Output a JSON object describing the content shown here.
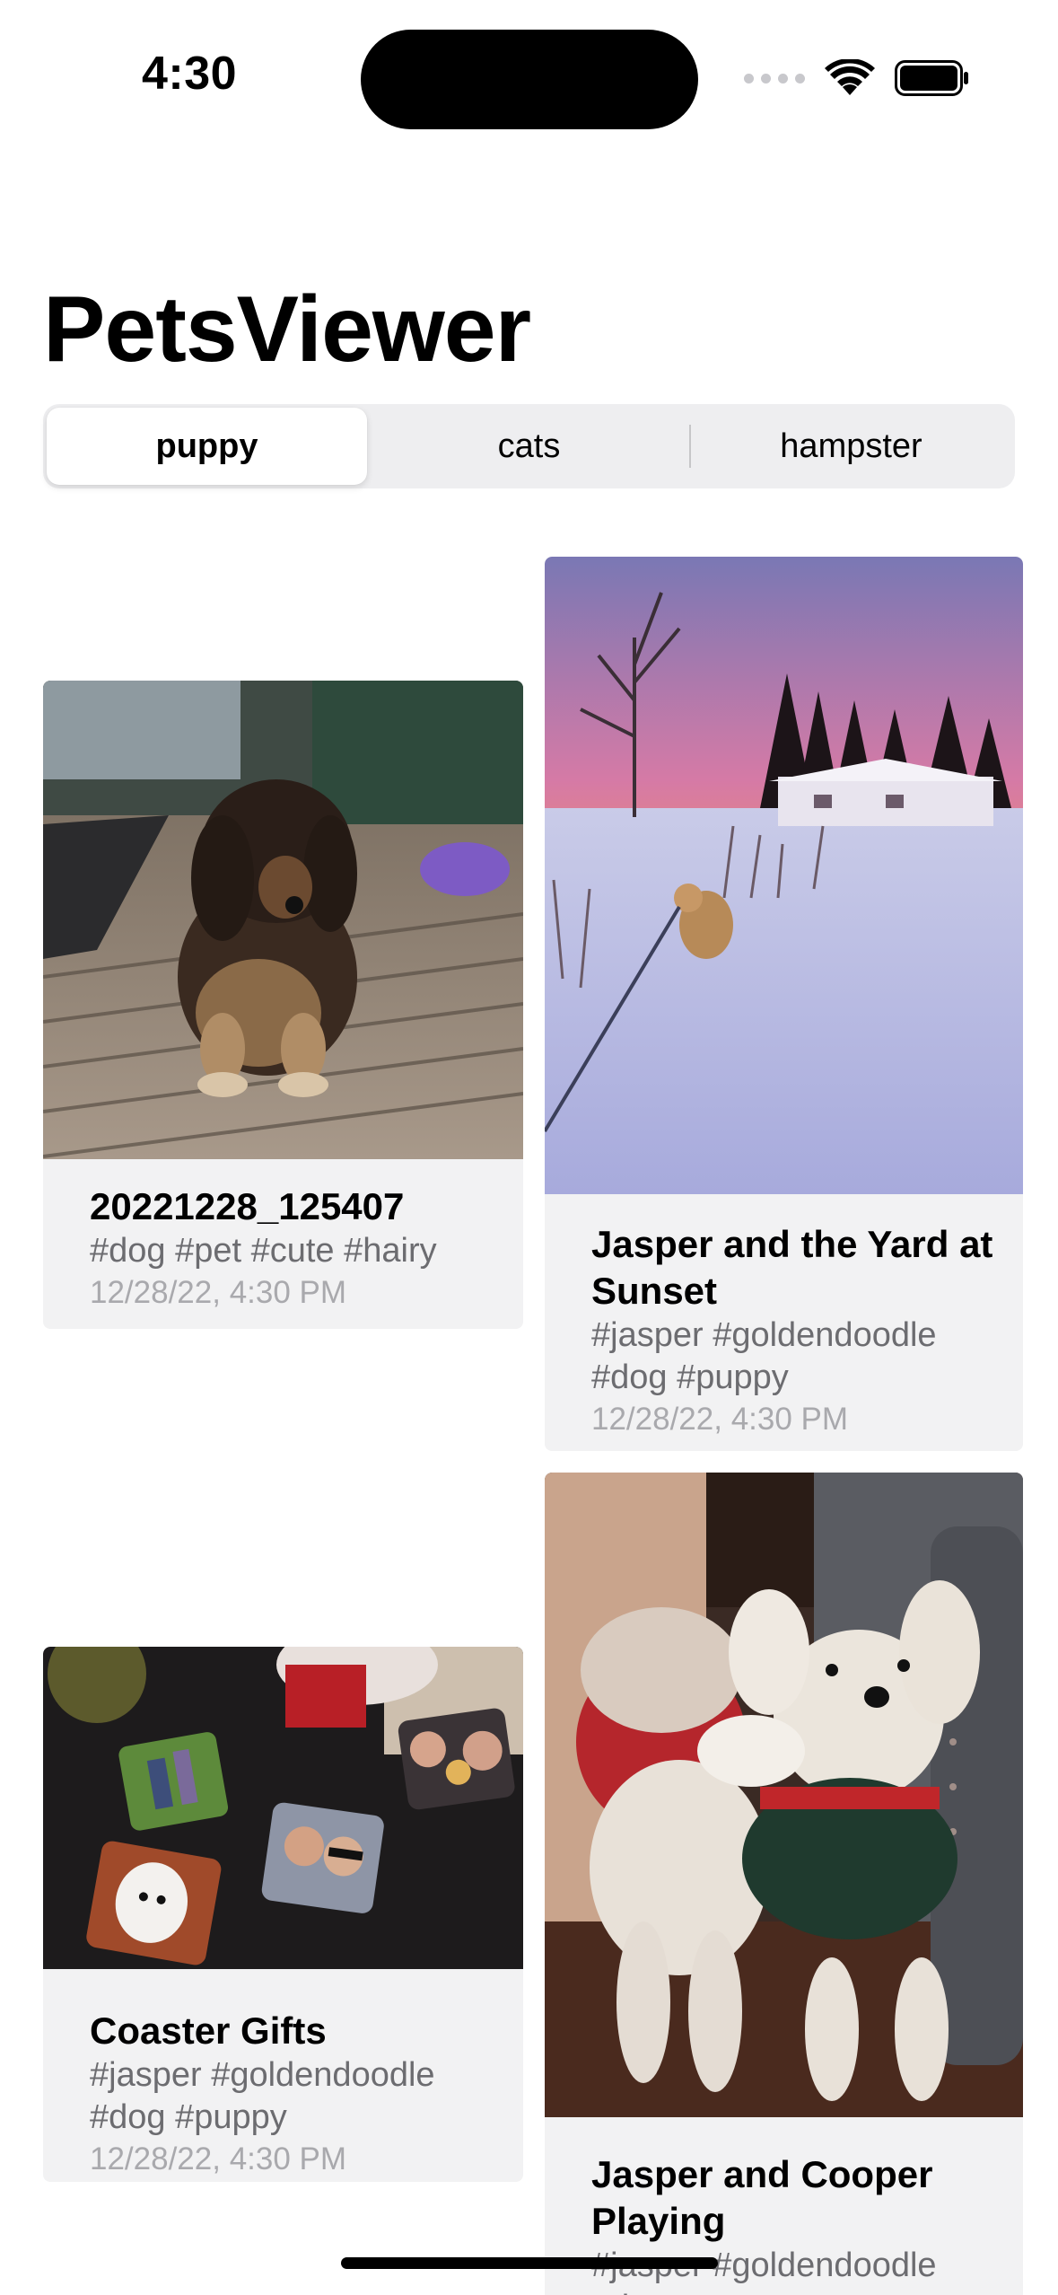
{
  "status_bar": {
    "time": "4:30"
  },
  "app": {
    "title": "PetsViewer"
  },
  "segments": [
    "puppy",
    "cats",
    "hampster"
  ],
  "selected_segment": "puppy",
  "cards": [
    {
      "title": "20221228_125407",
      "tags": "#dog #pet #cute #hairy",
      "date": "12/28/22, 4:30 PM",
      "photo_icon": "dog-on-deck-photo"
    },
    {
      "title": "Jasper and the Yard at Sunset",
      "tags": "#jasper #goldendoodle #dog #puppy",
      "date": "12/28/22, 4:30 PM",
      "photo_icon": "snowy-yard-sunset-photo"
    },
    {
      "title": "Coaster Gifts",
      "tags": "#jasper #goldendoodle #dog #puppy",
      "date": "12/28/22, 4:30 PM",
      "photo_icon": "photo-coasters-photo"
    },
    {
      "title": "Jasper and Cooper Playing",
      "tags": "#jasper #goldendoodle #dog #puppy",
      "date": "",
      "photo_icon": "two-dogs-playing-photo"
    }
  ],
  "colors": {
    "card_bg": "#f2f2f3",
    "tags": "#6c6c70",
    "date": "#a9a9ad",
    "segment_bg": "#eeeef0"
  }
}
